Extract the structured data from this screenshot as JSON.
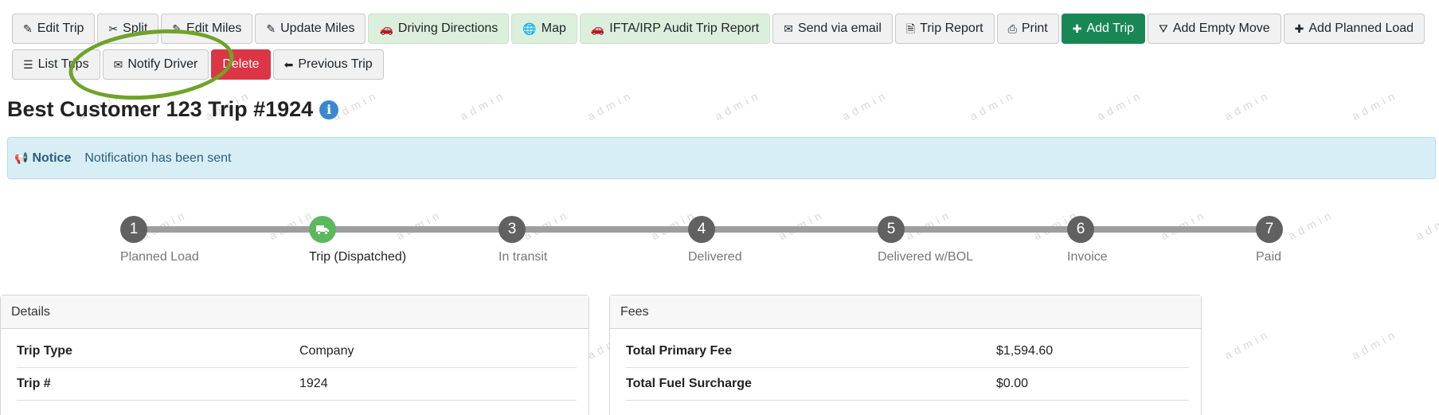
{
  "watermark": "admin",
  "toolbar": {
    "row1": [
      {
        "label": "Edit Trip",
        "icon": "pencil-icon",
        "style": "default"
      },
      {
        "label": "Split",
        "icon": "scissors-icon",
        "style": "default"
      },
      {
        "label": "Edit Miles",
        "icon": "pencil-icon",
        "style": "default"
      },
      {
        "label": "Update Miles",
        "icon": "pencil-icon",
        "style": "default"
      },
      {
        "label": "Driving Directions",
        "icon": "car-icon",
        "style": "green-light"
      },
      {
        "label": "Map",
        "icon": "globe-icon",
        "style": "green-light"
      },
      {
        "label": "IFTA/IRP Audit Trip Report",
        "icon": "car-icon",
        "style": "green-light"
      },
      {
        "label": "Send via email",
        "icon": "envelope-icon",
        "style": "default"
      },
      {
        "label": "Trip Report",
        "icon": "pdf-file-icon",
        "style": "default"
      },
      {
        "label": "Print",
        "icon": "printer-icon",
        "style": "default"
      },
      {
        "label": "Add Trip",
        "icon": "plus-icon",
        "style": "green"
      },
      {
        "label": "Add Empty Move",
        "icon": "road-icon",
        "style": "default"
      },
      {
        "label": "Add Planned Load",
        "icon": "plus-icon",
        "style": "default"
      }
    ],
    "row2": [
      {
        "label": "List Trips",
        "icon": "list-icon",
        "style": "default"
      },
      {
        "label": "Notify Driver",
        "icon": "envelope-icon",
        "style": "default"
      },
      {
        "label": "Delete",
        "icon": "",
        "style": "red"
      },
      {
        "label": "Previous Trip",
        "icon": "arrow-left-icon",
        "style": "default"
      }
    ]
  },
  "page_title": "Best Customer 123 Trip #1924",
  "notice": {
    "label": "Notice",
    "message": "Notification has been sent"
  },
  "steps": [
    {
      "number": "1",
      "label": "Planned Load",
      "active": false
    },
    {
      "number": "",
      "label": "Trip (Dispatched)",
      "active": true,
      "icon": "truck-icon"
    },
    {
      "number": "3",
      "label": "In transit",
      "active": false
    },
    {
      "number": "4",
      "label": "Delivered",
      "active": false
    },
    {
      "number": "5",
      "label": "Delivered w/BOL",
      "active": false
    },
    {
      "number": "6",
      "label": "Invoice",
      "active": false
    },
    {
      "number": "7",
      "label": "Paid",
      "active": false
    }
  ],
  "details": {
    "title": "Details",
    "rows": [
      {
        "key": "Trip Type",
        "value": "Company"
      },
      {
        "key": "Trip #",
        "value": "1924"
      }
    ]
  },
  "fees": {
    "title": "Fees",
    "rows": [
      {
        "key": "Total Primary Fee",
        "value": "$1,594.60"
      },
      {
        "key": "Total Fuel Surcharge",
        "value": "$0.00"
      }
    ]
  },
  "colors": {
    "add_trip_green": "#198754",
    "delete_red": "#dc3545",
    "notice_bg": "#d8eef7",
    "active_step": "#5cb85c",
    "annotation_circle": "#6fa329"
  }
}
